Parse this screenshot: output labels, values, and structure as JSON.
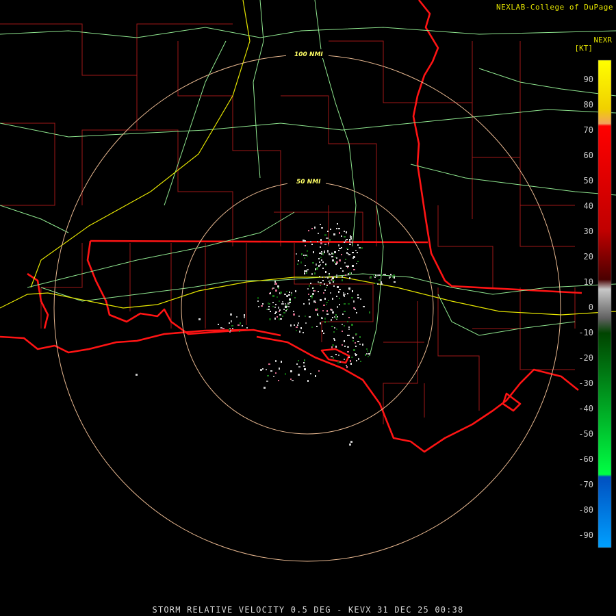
{
  "credit": "NEXLAB-College of DuPage",
  "product_code": "NEXR",
  "unit": "[KT]",
  "footer": "STORM RELATIVE VELOCITY 0.5 DEG - KEVX 31 DEC 25 00:38",
  "range_rings": [
    {
      "label": "50 NMI"
    },
    {
      "label": "100 NMI"
    }
  ],
  "color_scale": {
    "ticks": [
      "90",
      "80",
      "70",
      "60",
      "50",
      "40",
      "30",
      "20",
      "10",
      "0",
      "-10",
      "-20",
      "-30",
      "-40",
      "-50",
      "-60",
      "-70",
      "-80",
      "-90"
    ],
    "colors": {
      "top": "#ffff00",
      "orange": "#f2a25c",
      "red": "#ff0000",
      "darkred": "#4a0000",
      "gray": "#c8c8c8",
      "darkgreen": "#004400",
      "green": "#00ff44",
      "blue": "#0050c0",
      "lightblue": "#00a0ff"
    }
  },
  "map_colors": {
    "county": "#a01818",
    "state": "#ff1414",
    "highway": "#90e890",
    "interstate": "#e6e600",
    "ring": "#e8b890"
  }
}
